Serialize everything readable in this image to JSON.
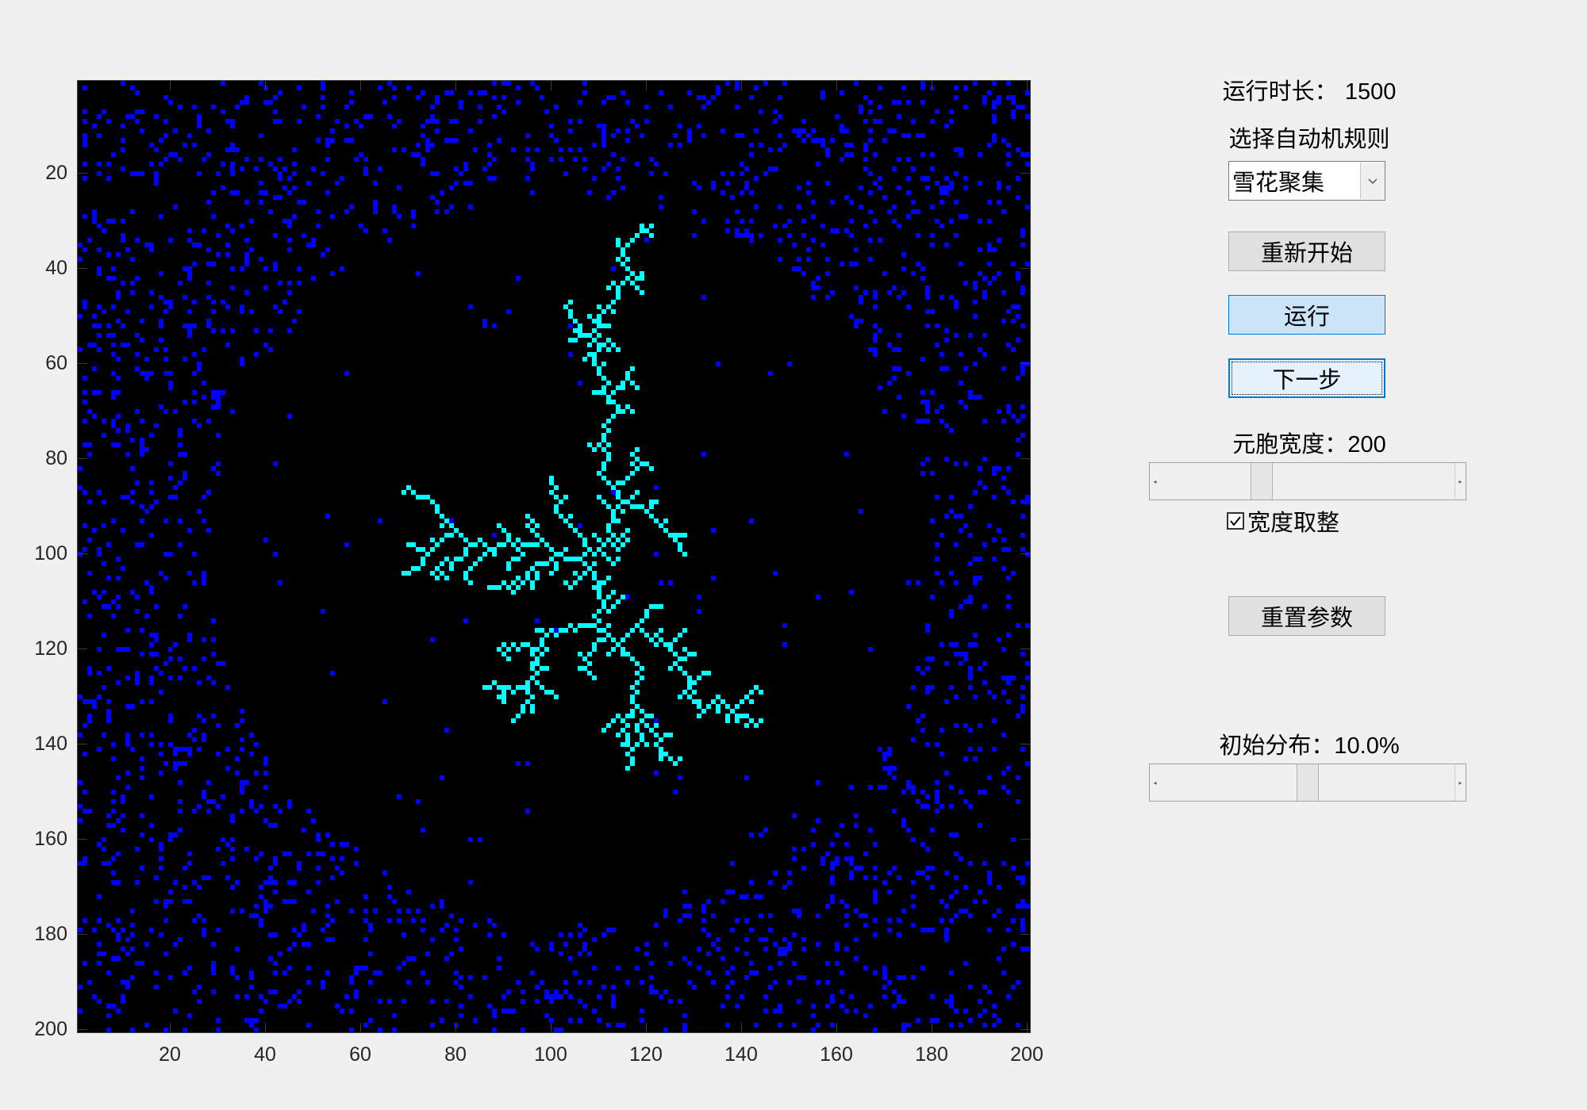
{
  "plot": {
    "grid_size": 200,
    "background_color": "#000000",
    "particle_color": "#0000ff",
    "crystal_color": "#00ffff",
    "y_ticks": [
      "20",
      "40",
      "60",
      "80",
      "100",
      "120",
      "140",
      "160",
      "180",
      "200"
    ],
    "x_ticks": [
      "20",
      "40",
      "60",
      "80",
      "100",
      "120",
      "140",
      "160",
      "180",
      "200"
    ]
  },
  "panel": {
    "runtime_label": "运行时长：",
    "runtime_value": "1500",
    "rule_label": "选择自动机规则",
    "rule_selected": "雪花聚集",
    "restart_button": "重新开始",
    "run_button": "运行",
    "step_button": "下一步",
    "cell_width_label": "元胞宽度：",
    "cell_width_value": "200",
    "cell_width_slider_level": 0.33,
    "round_width_checkbox": "宽度取整",
    "round_width_checked": true,
    "reset_button": "重置参数",
    "init_dist_label": "初始分布：",
    "init_dist_value": "10.0%",
    "init_dist_slider_level": 0.5
  }
}
